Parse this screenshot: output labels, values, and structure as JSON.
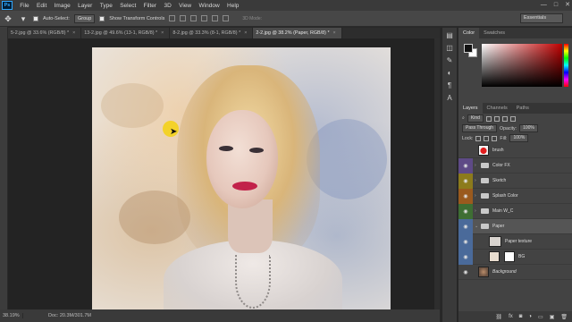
{
  "menu": {
    "items": [
      "File",
      "Edit",
      "Image",
      "Layer",
      "Type",
      "Select",
      "Filter",
      "3D",
      "View",
      "Window",
      "Help"
    ],
    "logo": "Ps",
    "window_controls": [
      "—",
      "□",
      "✕"
    ]
  },
  "options": {
    "auto_select_label": "Auto-Select:",
    "auto_select_target": "Group",
    "show_transform_label": "Show Transform Controls",
    "mode_3d_label": "3D Mode:",
    "workspace": "Essentials"
  },
  "tabs": [
    {
      "label": "5-2.jpg @ 33.6% (RGB/8) *",
      "active": false
    },
    {
      "label": "13-2.jpg @ 49.6% (13-1, RGB/8) *",
      "active": false
    },
    {
      "label": "8-2.jpg @ 33.3% (8-1, RGB/8) *",
      "active": false
    },
    {
      "label": "2-2.jpg @ 38.2% (Paper, RGB/8) *",
      "active": true
    }
  ],
  "status": {
    "zoom": "38.19%",
    "doc": "Doc: 20.3M/301.7M"
  },
  "color_panel": {
    "tabs": [
      "Color",
      "Swatches"
    ],
    "foreground": "#111111",
    "background": "#ffffff",
    "accent": "#c00000"
  },
  "layers_panel": {
    "tabs": [
      "Layers",
      "Channels",
      "Paths"
    ],
    "kind_label": "Kind",
    "blend_mode": "Pass Through",
    "opacity_label": "Opacity:",
    "opacity_value": "100%",
    "lock_label": "Lock:",
    "fill_label": "Fill:",
    "fill_value": "100%",
    "layers": [
      {
        "name": "brush",
        "type": "layer",
        "thumb": "brush",
        "eye": false,
        "color": ""
      },
      {
        "name": "Color FX",
        "type": "group",
        "eye": true,
        "color": "violet"
      },
      {
        "name": "Sketch",
        "type": "group",
        "eye": true,
        "color": "yellow"
      },
      {
        "name": "Splash Color",
        "type": "group",
        "eye": true,
        "color": "orange"
      },
      {
        "name": "Main W_C",
        "type": "group",
        "eye": true,
        "color": "green"
      },
      {
        "name": "Paper",
        "type": "group-open",
        "eye": true,
        "color": "blue",
        "selected": true
      },
      {
        "name": "Paper texture",
        "type": "child",
        "thumb": "paper",
        "eye": true,
        "color": "blue"
      },
      {
        "name": "BG",
        "type": "child-mask",
        "thumb": "bg1",
        "eye": true,
        "color": "blue"
      },
      {
        "name": "Background",
        "type": "background",
        "thumb": "photo",
        "eye": true,
        "color": "",
        "italic": true
      }
    ]
  }
}
